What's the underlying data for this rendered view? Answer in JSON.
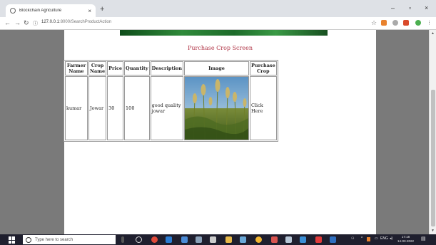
{
  "browser": {
    "tab_title": "Blockchain Agriculture",
    "tab_close": "×",
    "new_tab": "+",
    "url_host": "127.0.0.1",
    "url_rest": ":8000/SearchProductAction",
    "star": "☆"
  },
  "window_controls": {
    "minimize": "–",
    "maximize": "▫",
    "close": "×"
  },
  "page": {
    "title": "Purchase Crop Screen"
  },
  "table": {
    "headers": [
      "Farmer Name",
      "Crop Name",
      "Price",
      "Quantity",
      "Description",
      "Image",
      "Purchase Crop"
    ],
    "rows": [
      {
        "farmer": "kumar",
        "crop": "Jowar",
        "price": "30",
        "quantity": "100",
        "description": "good quality jowar",
        "image": "jowar-field-photo",
        "purchase": "Click Here"
      }
    ]
  },
  "taskbar": {
    "search_placeholder": "Type here to search",
    "time": "17:18",
    "date": "14-03-2022",
    "language": "ENG"
  },
  "colors": {
    "title": "#b2394a",
    "gutter": "#7a7a7a",
    "taskbar": "#1f1f2e"
  }
}
